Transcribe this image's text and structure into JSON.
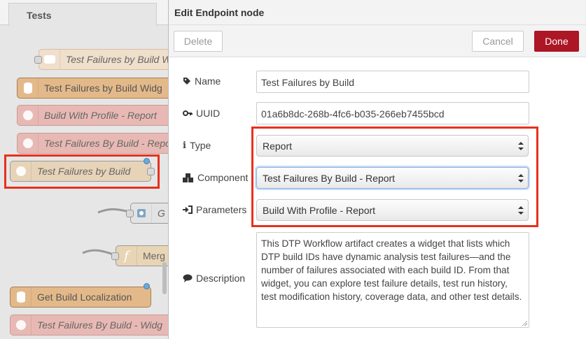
{
  "workspace": {
    "tab_label": "Tests",
    "nodes": [
      {
        "label": "Test Failures by Build W",
        "style": "faded",
        "icon": "comment-icon"
      },
      {
        "label": "Test Failures by Build Widg",
        "style": "db",
        "icon": "database-icon"
      },
      {
        "label": "Build With Profile - Report",
        "style": "pink",
        "icon": "globe-icon"
      },
      {
        "label": "Test Failures By Build - Repo",
        "style": "pink",
        "icon": "globe-icon"
      },
      {
        "label": "Test Failures by Build",
        "style": "normal",
        "icon": "globe-icon"
      },
      {
        "label": "G",
        "style": "node",
        "icon": "gear-icon"
      },
      {
        "label": "Merg",
        "style": "node",
        "icon": "function-icon"
      },
      {
        "label": "Get Build Localization",
        "style": "db",
        "icon": "database-icon"
      },
      {
        "label": "Test Failures By Build - Widg",
        "style": "pink",
        "icon": "globe-icon"
      }
    ]
  },
  "tray": {
    "title": "Edit Endpoint node",
    "delete_label": "Delete",
    "cancel_label": "Cancel",
    "done_label": "Done",
    "accent_color": "#ad1625",
    "fields": {
      "name": {
        "label": "Name",
        "value": "Test Failures by Build"
      },
      "uuid": {
        "label": "UUID",
        "value": "01a6b8dc-268b-4fc6-b035-266eb7455bcd"
      },
      "type": {
        "label": "Type",
        "value": "Report"
      },
      "component": {
        "label": "Component",
        "value": "Test Failures By Build - Report"
      },
      "parameters": {
        "label": "Parameters",
        "value": "Build With Profile - Report"
      },
      "description": {
        "label": "Description",
        "value": "This DTP Workflow artifact creates a widget that lists which DTP build IDs have dynamic analysis test failures—and the number of failures associated with each build ID.  From that widget, you can explore test failure details, test run history, test modification history, coverage data, and other test details."
      }
    }
  }
}
